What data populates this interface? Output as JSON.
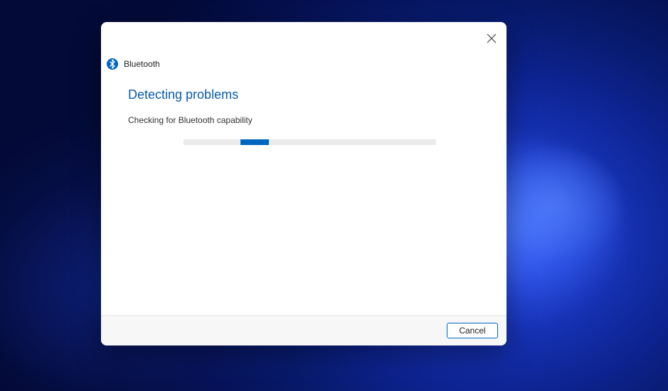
{
  "dialog": {
    "title": "Bluetooth",
    "heading": "Detecting problems",
    "status_text": "Checking for Bluetooth capability",
    "cancel_label": "Cancel",
    "icon": "bluetooth-icon",
    "progress": {
      "indeterminate": true,
      "chunk_position_percent": 22
    },
    "colors": {
      "accent": "#0067c0",
      "heading": "#0b5cab",
      "track": "#eaeaea"
    }
  }
}
